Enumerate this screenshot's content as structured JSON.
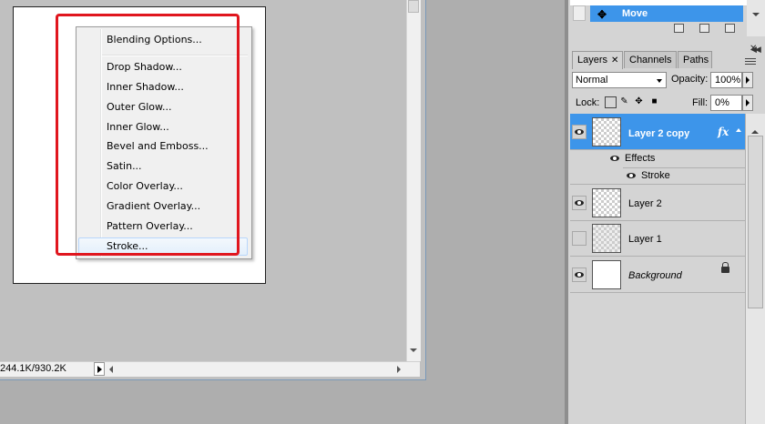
{
  "document": {
    "status_text": "244.1K/930.2K"
  },
  "context_menu": {
    "items": [
      {
        "label": "Blending Options..."
      },
      {
        "label": "Drop Shadow..."
      },
      {
        "label": "Inner Shadow..."
      },
      {
        "label": "Outer Glow..."
      },
      {
        "label": "Inner Glow..."
      },
      {
        "label": "Bevel and Emboss..."
      },
      {
        "label": "Satin..."
      },
      {
        "label": "Color Overlay..."
      },
      {
        "label": "Gradient Overlay..."
      },
      {
        "label": "Pattern Overlay..."
      },
      {
        "label": "Stroke..."
      }
    ],
    "hovered": "Stroke..."
  },
  "history": {
    "active_state": "Move"
  },
  "layers_panel": {
    "tabs": [
      "Layers",
      "Channels",
      "Paths"
    ],
    "active_tab": "Layers",
    "blend_mode": "Normal",
    "opacity_label": "Opacity:",
    "opacity_value": "100%",
    "lock_label": "Lock:",
    "fill_label": "Fill:",
    "fill_value": "0%",
    "layers": [
      {
        "name": "Layer 2 copy",
        "visible": true,
        "selected": true,
        "has_fx": true
      },
      {
        "name": "Layer 2",
        "visible": true,
        "selected": false
      },
      {
        "name": "Layer 1",
        "visible": false,
        "selected": false
      },
      {
        "name": "Background",
        "visible": true,
        "selected": false,
        "locked": true
      }
    ],
    "effects_label": "Effects",
    "effect_items": [
      "Stroke"
    ],
    "fx_symbol": "fx"
  },
  "colors": {
    "selection_blue": "#3d95ea",
    "highlight_red": "#e0161e"
  }
}
